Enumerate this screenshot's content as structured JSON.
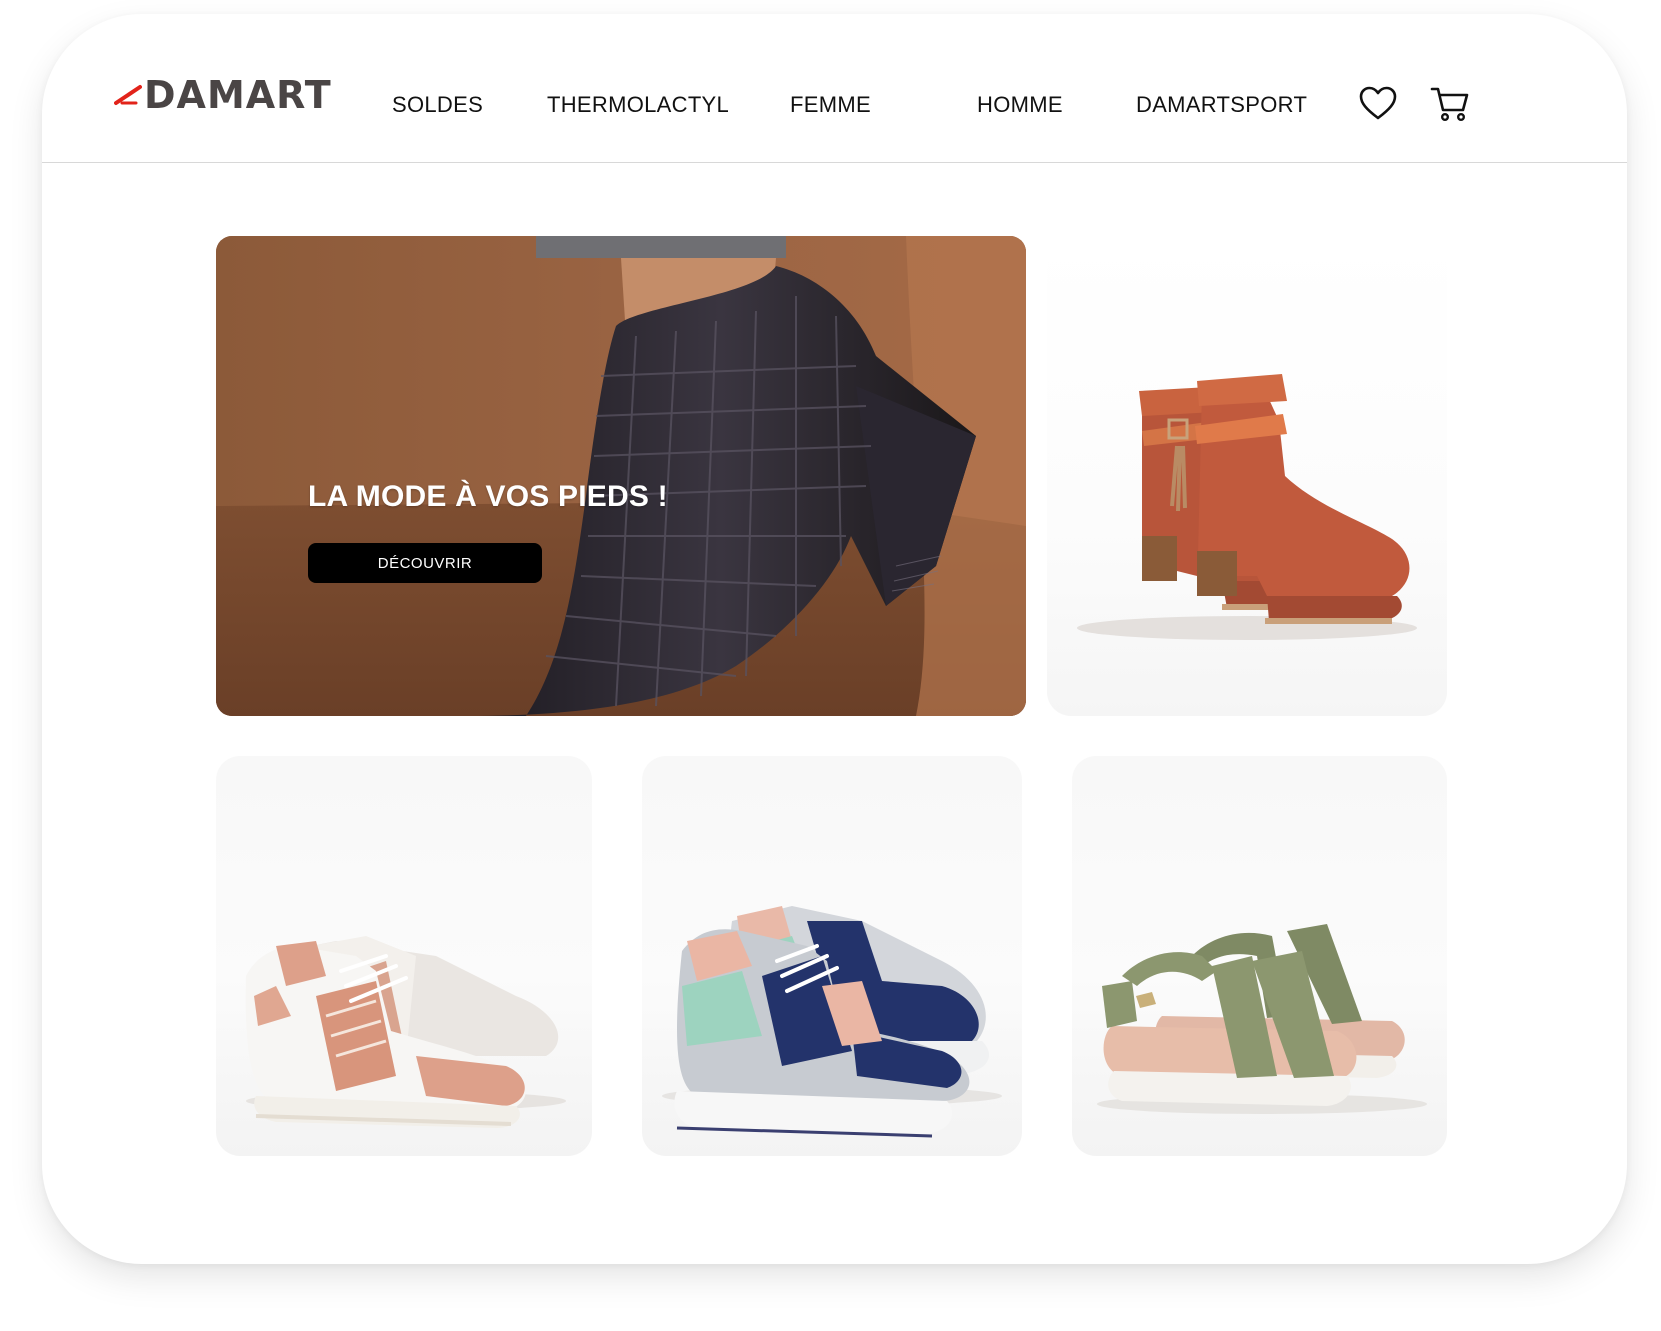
{
  "header": {
    "logo_text": "DAMART",
    "nav": [
      {
        "label": "SOLDES"
      },
      {
        "label": "THERMOLACTYL"
      },
      {
        "label": "FEMME"
      },
      {
        "label": "HOMME"
      },
      {
        "label": "DAMARTSPORT"
      }
    ],
    "icons": {
      "wishlist": "heart-icon",
      "cart": "cart-icon"
    }
  },
  "hero": {
    "title": "LA MODE À VOS PIEDS !",
    "button_label": "DÉCOUVRIR",
    "product": "black croc-embossed heeled ankle boot"
  },
  "products": [
    {
      "product": "rust suede ankle boots with tassel strap"
    },
    {
      "product": "white and pink leather sneakers"
    },
    {
      "product": "navy, grey and mint running sneakers"
    },
    {
      "product": "khaki strap sandals"
    }
  ],
  "colors": {
    "brand_red": "#e2231a",
    "logo_grey": "#4a4545",
    "hero_brown": "#8a5a3a",
    "button_black": "#000000"
  }
}
